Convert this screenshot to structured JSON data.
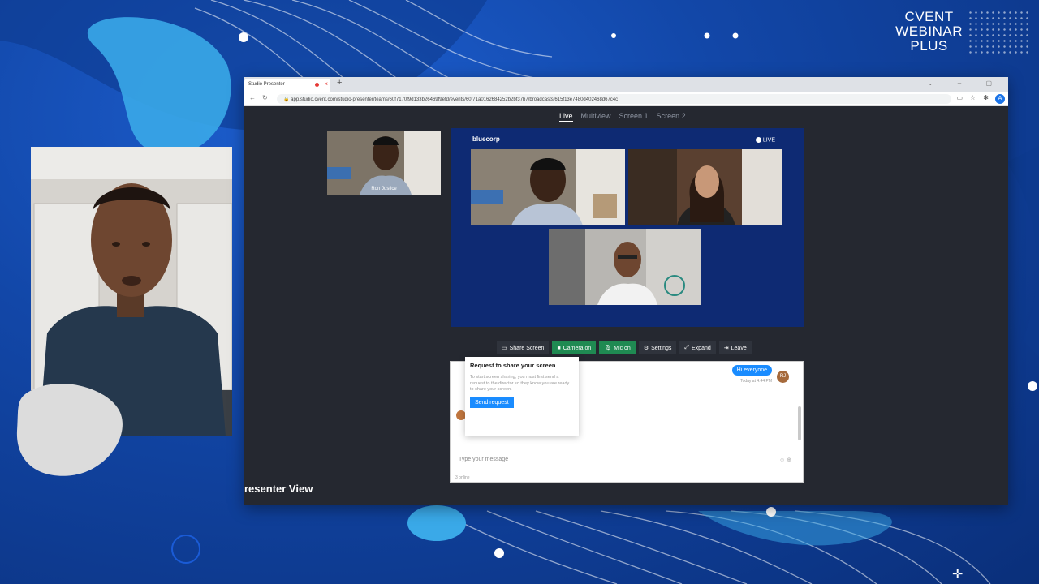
{
  "brand": {
    "line1": "CVENT",
    "line2": "WEBINAR",
    "line3": "PLUS"
  },
  "browser": {
    "tab_title": "Studio Presenter",
    "tab_close": "×",
    "new_tab": "+",
    "window_controls": "⌄ – ▢",
    "url": "app.studio.cvent.com/studio-presenter/teams/60f7170f9d133b26469f9efd/events/60f71a0162684252b2bf37b7/broadcasts/615f13e7480d402468d67c4c",
    "profile_initial": "A"
  },
  "view_tabs": [
    {
      "label": "Live",
      "active": true
    },
    {
      "label": "Multiview",
      "active": false
    },
    {
      "label": "Screen 1",
      "active": false
    },
    {
      "label": "Screen 2",
      "active": false
    }
  ],
  "self_preview": {
    "name": "Ron Justice"
  },
  "stage": {
    "logo": "bluecorp",
    "live_label": "LIVE"
  },
  "controls": {
    "share_screen": "Share Screen",
    "camera": "Camera on",
    "mic": "Mic on",
    "settings": "Settings",
    "expand": "Expand",
    "leave": "Leave"
  },
  "chat": {
    "message": "Hi everyone",
    "time": "Today at 4:44 PM",
    "avatar_initials": "RJ",
    "placeholder": "Type your message",
    "online": "3 online",
    "input_icons": "☺ ⊕"
  },
  "share_popup": {
    "title": "Request to share your screen",
    "text": "To start screen sharing, you must first send a request to the director so they know you are ready to share your screen.",
    "button": "Send request"
  },
  "page_title": "resenter View",
  "colors": {
    "accent": "#1a8cff",
    "green": "#1f8a52",
    "stage_bg": "#0e2a73"
  }
}
